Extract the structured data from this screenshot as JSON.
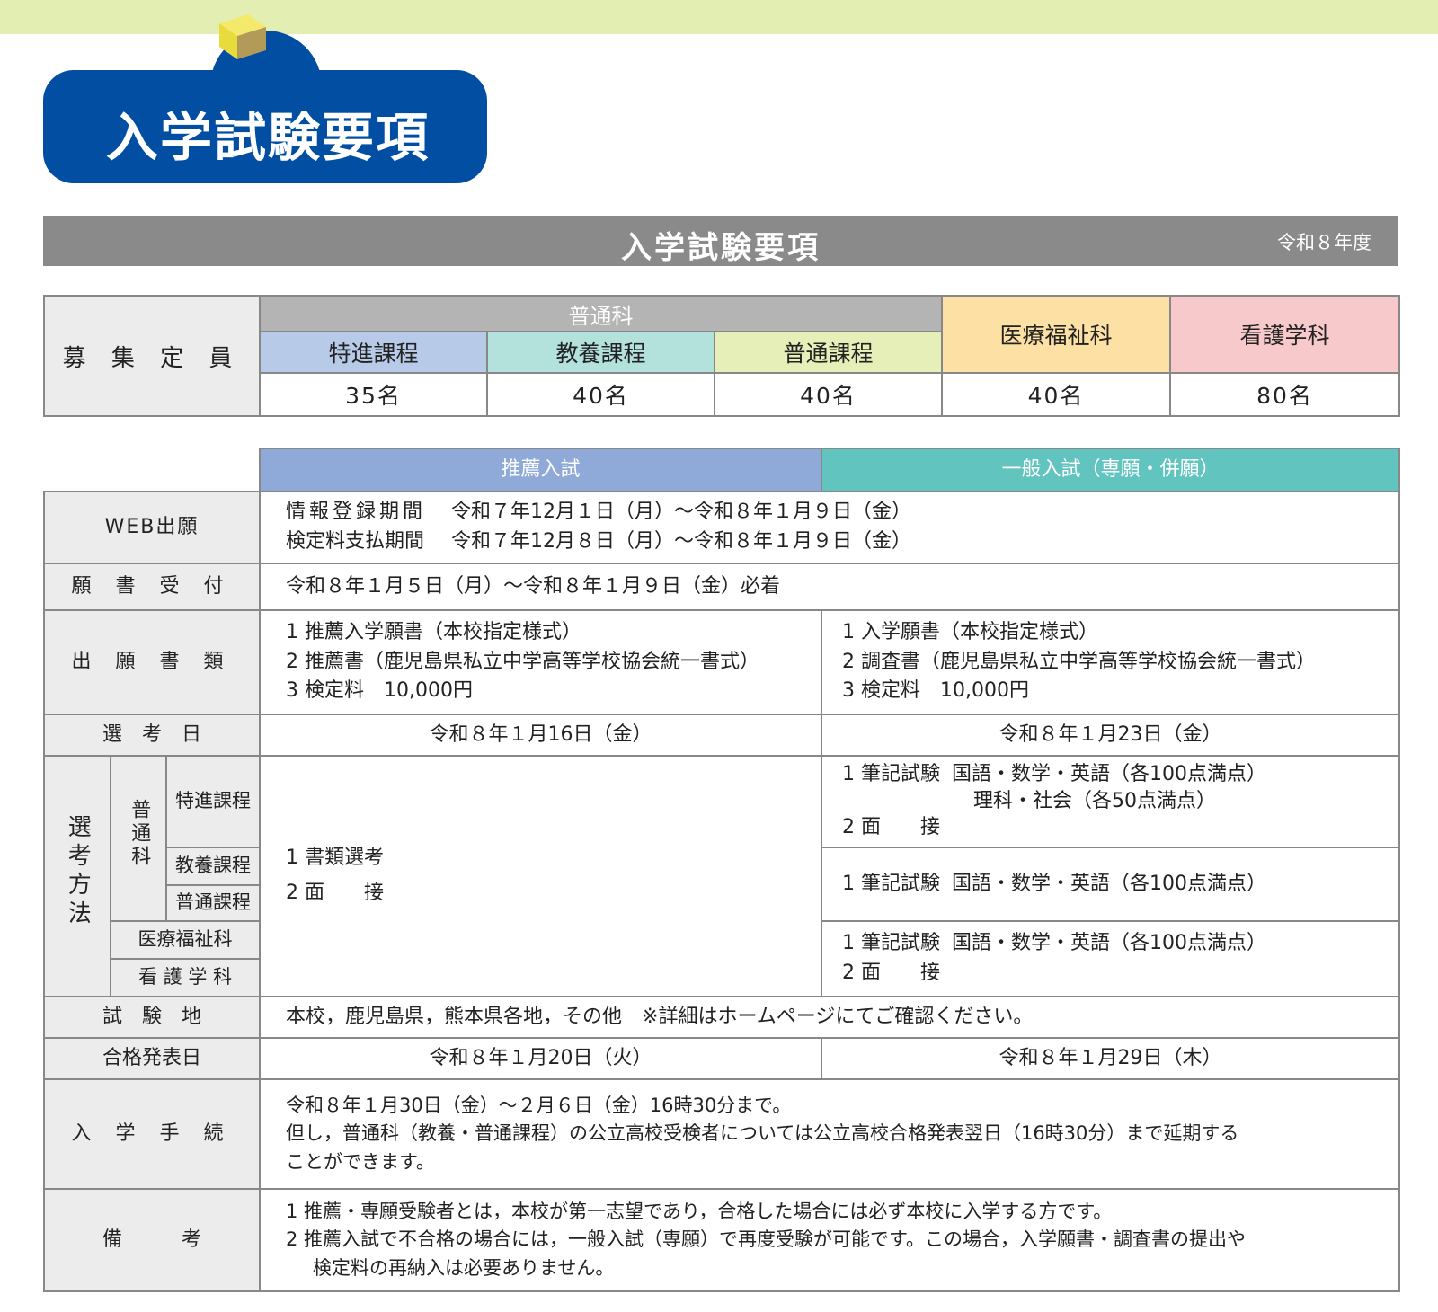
{
  "hero": {
    "title": "入学試験要項"
  },
  "header": {
    "title": "入学試験要項",
    "year": "令和８年度"
  },
  "capacity": {
    "label": "募 集 定 員",
    "futsuka": "普通科",
    "tokushin": "特進課程",
    "kyoyo": "教養課程",
    "futsu": "普通課程",
    "iryo": "医療福祉科",
    "kango": "看護学科",
    "n_tokushin": "35名",
    "n_kyoyo": "40名",
    "n_futsu": "40名",
    "n_iryo": "40名",
    "n_kango": "80名"
  },
  "exam": {
    "col_suisen": "推薦入試",
    "col_ippan": "一般入試（専願・併願）",
    "web": {
      "label": "WEB出願",
      "l1_k": "情報登録期間",
      "l1_v": "令和７年12月１日（月）～令和８年１月９日（金）",
      "l2_k": "検定料支払期間",
      "l2_v": "令和７年12月８日（月）～令和８年１月９日（金）"
    },
    "gansho": {
      "label": "願 書 受 付",
      "value": "令和８年１月５日（月）～令和８年１月９日（金）必着"
    },
    "shorui": {
      "label": "出 願 書 類",
      "s1": "1  推薦入学願書（本校指定様式）",
      "s2": "2  推薦書（鹿児島県私立中学高等学校協会統一書式）",
      "s3": "3  検定料　10,000円",
      "g1": "1  入学願書（本校指定様式）",
      "g2": "2  調査書（鹿児島県私立中学高等学校協会統一書式）",
      "g3": "3  検定料　10,000円"
    },
    "senkobi": {
      "label": "選　考　日",
      "suisen": "令和８年１月16日（金）",
      "ippan": "令和８年１月23日（金）"
    },
    "hoho": {
      "label": "選考方法",
      "futsuka": "普通科",
      "tokushin": "特進課程",
      "kyoyo": "教養課程",
      "futsu": "普通課程",
      "iryo": "医療福祉科",
      "kango": "看 護 学 科",
      "suisen_1": "1  書類選考",
      "suisen_2": "2  面　　接",
      "tok_1k": "1  筆記試験",
      "tok_1v": "国語・数学・英語（各100点満点）",
      "tok_1v2": "理科・社会（各50点満点）",
      "tok_2": "2  面　　接",
      "kyo_1k": "1  筆記試験",
      "kyo_1v": "国語・数学・英語（各100点満点）",
      "iry_1k": "1  筆記試験",
      "iry_1v": "国語・数学・英語（各100点満点）",
      "iry_2": "2  面　　接"
    },
    "chi": {
      "label": "試　験　地",
      "value": "本校，鹿児島県，熊本県各地，その他　※詳細はホームページにてご確認ください。"
    },
    "happyo": {
      "label": "合格発表日",
      "suisen": "令和８年１月20日（火）",
      "ippan": "令和８年１月29日（木）"
    },
    "tetsuzuki": {
      "label": "入 学 手 続",
      "l1": "令和８年１月30日（金）～２月６日（金）16時30分まで。",
      "l2": "但し，普通科（教養・普通課程）の公立高校受検者については公立高校合格発表翌日（16時30分）まで延期する",
      "l3": "ことができます。"
    },
    "biko": {
      "label": "備　　　考",
      "l1": "1  推薦・専願受験者とは，本校が第一志望であり，合格した場合には必ず本校に入学する方です。",
      "l2": "2  推薦入試で不合格の場合には，一般入試（専願）で再度受験が可能です。この場合，入学願書・調査書の提出や",
      "l3": "検定料の再納入は必要ありません。"
    }
  },
  "colors": {
    "hero_blue": "#024ea2",
    "header_gray": "#8a8a8a",
    "top_band": "#e3eeb3"
  }
}
